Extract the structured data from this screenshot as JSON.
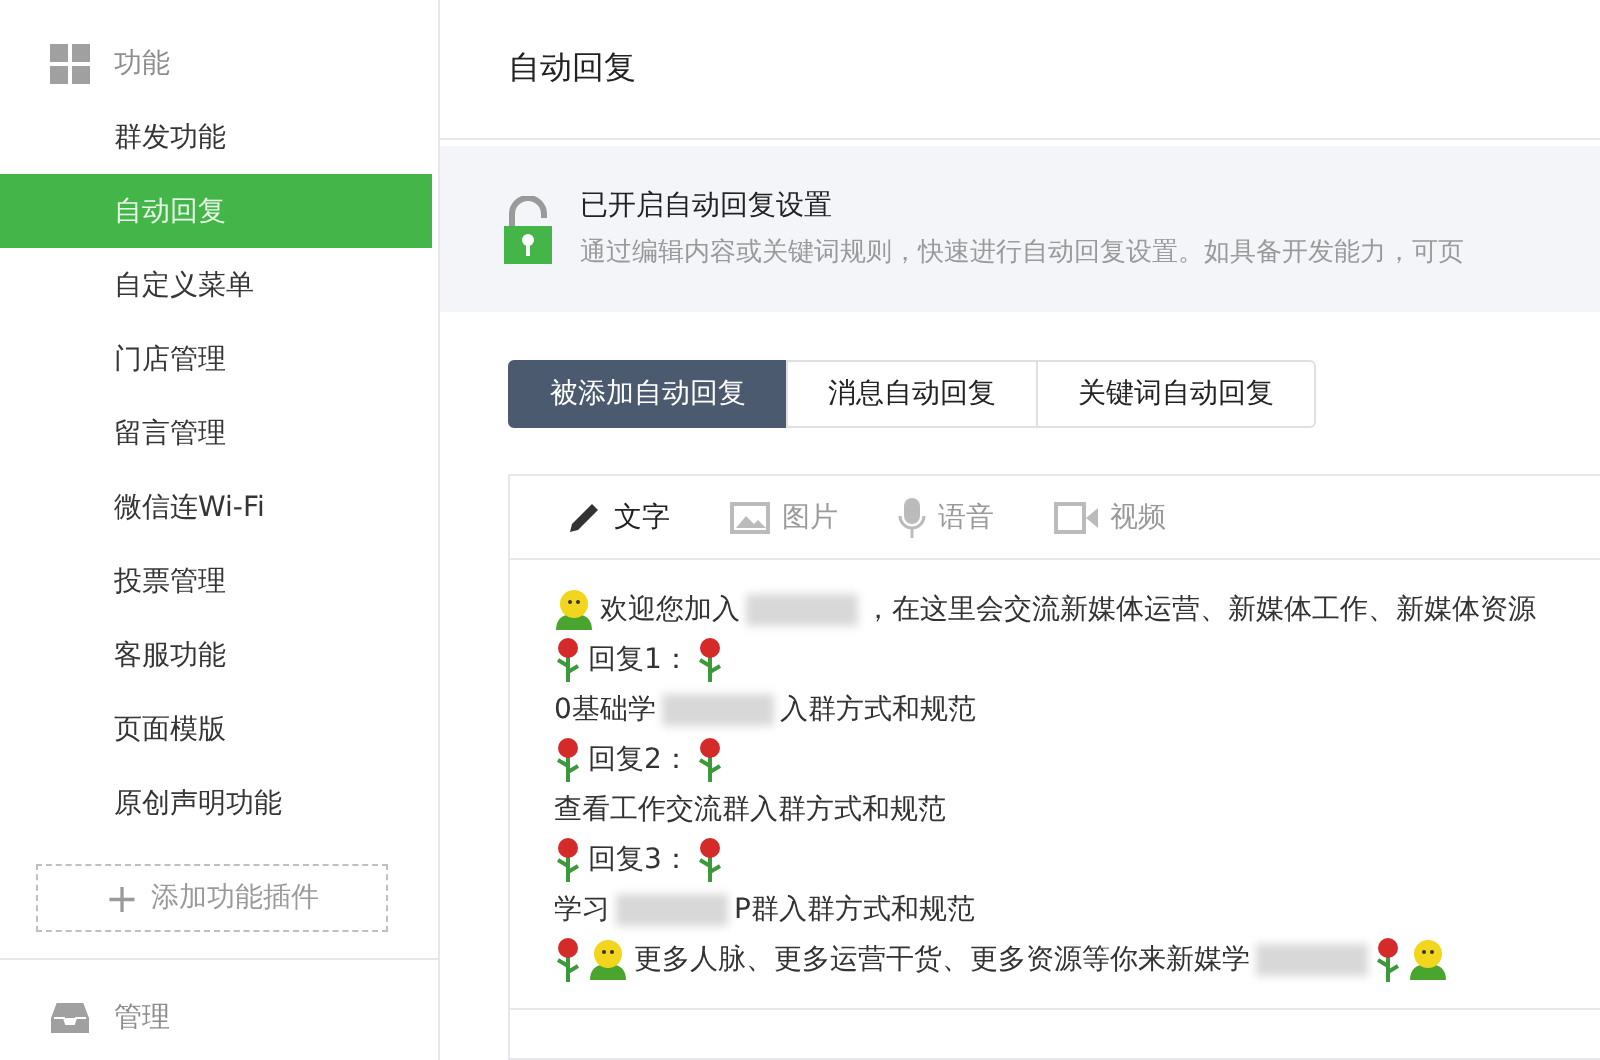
{
  "sidebar": {
    "section": {
      "label": "功能"
    },
    "items": [
      {
        "label": "群发功能",
        "selected": false
      },
      {
        "label": "自动回复",
        "selected": true
      },
      {
        "label": "自定义菜单",
        "selected": false
      },
      {
        "label": "门店管理",
        "selected": false
      },
      {
        "label": "留言管理",
        "selected": false
      },
      {
        "label": "微信连Wi-Fi",
        "selected": false
      },
      {
        "label": "投票管理",
        "selected": false
      },
      {
        "label": "客服功能",
        "selected": false
      },
      {
        "label": "页面模版",
        "selected": false
      },
      {
        "label": "原创声明功能",
        "selected": false
      }
    ],
    "add_plugin": {
      "icon": "+",
      "label": "添加功能插件"
    },
    "footer_section": {
      "label": "管理"
    }
  },
  "page_title": "自动回复",
  "banner": {
    "title": "已开启自动回复设置",
    "description": "通过编辑内容或关键词规则，快速进行自动回复设置。如具备开发能力，可页"
  },
  "tabs": [
    {
      "label": "被添加自动回复",
      "selected": true
    },
    {
      "label": "消息自动回复",
      "selected": false
    },
    {
      "label": "关键词自动回复",
      "selected": false
    }
  ],
  "editor": {
    "media_types": [
      {
        "kind": "text",
        "label": "文字",
        "selected": true
      },
      {
        "kind": "image",
        "label": "图片",
        "selected": false
      },
      {
        "kind": "voice",
        "label": "语音",
        "selected": false
      },
      {
        "kind": "video",
        "label": "视频",
        "selected": false
      }
    ],
    "lines": [
      [
        {
          "kind": "smiley"
        },
        {
          "kind": "text",
          "text": "欢迎您加入"
        },
        {
          "kind": "blur"
        },
        {
          "kind": "text",
          "text": "，在这里会交流新媒体运营、新媒体工作、新媒体资源"
        }
      ],
      [
        {
          "kind": "rose"
        },
        {
          "kind": "text",
          "text": "回复1："
        },
        {
          "kind": "rose"
        }
      ],
      [
        {
          "kind": "text",
          "text": "0基础学"
        },
        {
          "kind": "blur"
        },
        {
          "kind": "text",
          "text": "入群方式和规范"
        }
      ],
      [
        {
          "kind": "rose"
        },
        {
          "kind": "text",
          "text": "回复2："
        },
        {
          "kind": "rose"
        }
      ],
      [
        {
          "kind": "text",
          "text": "查看工作交流群入群方式和规范"
        }
      ],
      [
        {
          "kind": "rose"
        },
        {
          "kind": "text",
          "text": "回复3："
        },
        {
          "kind": "rose"
        }
      ],
      [
        {
          "kind": "text",
          "text": "学习"
        },
        {
          "kind": "blur"
        },
        {
          "kind": "text",
          "text": "P群入群方式和规范"
        }
      ],
      [
        {
          "kind": "rose"
        },
        {
          "kind": "smiley"
        },
        {
          "kind": "text",
          "text": "更多人脉、更多运营干货、更多资源等你来新媒学"
        },
        {
          "kind": "blur"
        },
        {
          "kind": "rose"
        },
        {
          "kind": "smiley"
        }
      ]
    ]
  }
}
